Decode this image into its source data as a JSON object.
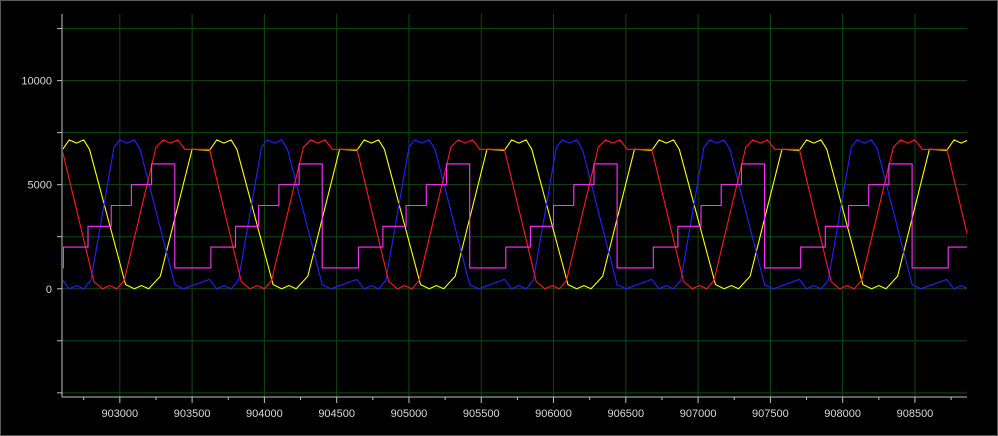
{
  "chart_data": {
    "type": "line",
    "title": "",
    "xlabel": "",
    "ylabel": "",
    "xlim": [
      902600,
      908860
    ],
    "ylim": [
      -5200,
      13200
    ],
    "grid": true,
    "xticks": [
      903000,
      903500,
      904000,
      904500,
      905000,
      905500,
      906000,
      906500,
      907000,
      907500,
      908000,
      908500
    ],
    "xtick_labels": [
      "903000",
      "903500",
      "904000",
      "904500",
      "905000",
      "905500",
      "906000",
      "906500",
      "907000",
      "907500",
      "908000",
      "908500"
    ],
    "yticks": [
      0,
      5000,
      10000
    ],
    "ytick_labels": [
      "0",
      "5000",
      "10000"
    ],
    "period": 1020,
    "series": [
      {
        "color": "#ffff00",
        "kind": "trapezoid",
        "min": 0,
        "max": 7150,
        "phase_start": 902620,
        "first_points": [
          [
            902600,
            6650
          ],
          [
            902620,
            6850
          ],
          [
            902650,
            7150
          ],
          [
            902700,
            7000
          ],
          [
            902750,
            7150
          ],
          [
            902790,
            6700
          ],
          [
            903040,
            200
          ],
          [
            903100,
            0
          ],
          [
            903150,
            150
          ],
          [
            903200,
            0
          ],
          [
            903280,
            600
          ],
          [
            903500,
            6700
          ]
        ]
      },
      {
        "color": "#2222ff",
        "kind": "trapezoid",
        "min": 0,
        "max": 7150,
        "phase_start": 902960,
        "first_points": [
          [
            902600,
            450
          ],
          [
            902650,
            0
          ],
          [
            902700,
            150
          ],
          [
            902750,
            0
          ],
          [
            902800,
            400
          ],
          [
            902960,
            6800
          ],
          [
            903000,
            7150
          ],
          [
            903050,
            7000
          ],
          [
            903100,
            7150
          ],
          [
            903140,
            6700
          ],
          [
            903380,
            200
          ],
          [
            903440,
            0
          ]
        ]
      },
      {
        "color": "#ff1a1a",
        "kind": "trapezoid",
        "min": 0,
        "max": 7150,
        "phase_start": 902600,
        "first_points": [
          [
            902600,
            6700
          ],
          [
            902820,
            350
          ],
          [
            902880,
            0
          ],
          [
            902930,
            150
          ],
          [
            902980,
            0
          ],
          [
            903030,
            400
          ],
          [
            903250,
            6800
          ],
          [
            903300,
            7150
          ],
          [
            903350,
            7000
          ],
          [
            903400,
            7150
          ],
          [
            903450,
            6700
          ]
        ]
      },
      {
        "color": "#ff33ff",
        "kind": "step",
        "min": 1000,
        "max": 6000,
        "step_values": [
          1000,
          2000,
          3000,
          4000,
          5000,
          6000
        ],
        "phase_start": 902610,
        "first_points": [
          [
            902600,
            1000
          ],
          [
            902610,
            2000
          ],
          [
            902780,
            3000
          ],
          [
            902940,
            4000
          ],
          [
            903080,
            5000
          ],
          [
            903220,
            6000
          ],
          [
            903380,
            1000
          ]
        ]
      }
    ]
  }
}
